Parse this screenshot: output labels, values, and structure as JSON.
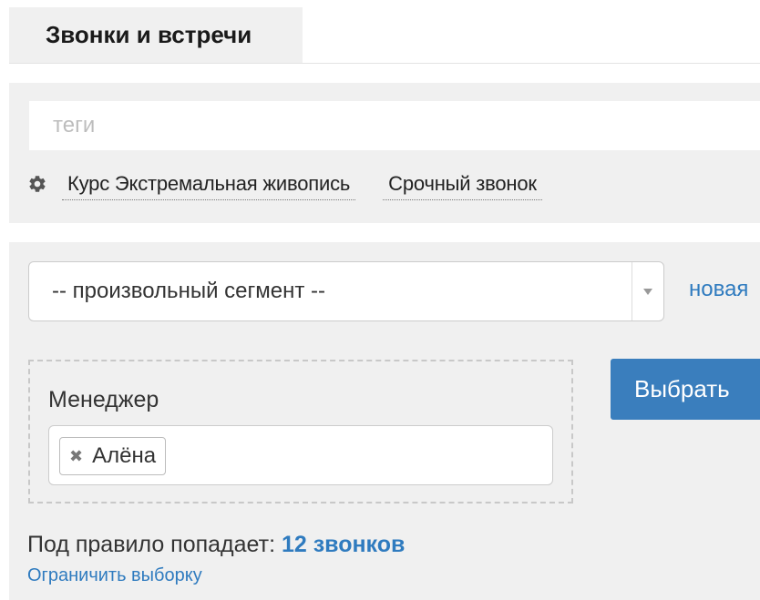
{
  "tabs": {
    "active_label": "Звонки и встречи"
  },
  "tags": {
    "placeholder": "теги",
    "items": [
      {
        "label": "Курс Экстремальная живопись"
      },
      {
        "label": "Срочный звонок"
      }
    ]
  },
  "segment": {
    "selected": "-- произвольный сегмент --",
    "new_link": "новая"
  },
  "rule": {
    "label": "Менеджер",
    "chips": [
      {
        "label": "Алёна",
        "remove_symbol": "✖"
      }
    ],
    "select_button": "Выбрать"
  },
  "summary": {
    "prefix": "Под правило попадает: ",
    "count_text": "12 звонков",
    "limit_link": "Ограничить выборку"
  },
  "colors": {
    "accent": "#2f7bbf",
    "button": "#3a7ebd",
    "panel_bg": "#f0f0f0"
  },
  "icons": {
    "tags_icon": "gear-icon",
    "dropdown_icon": "chevron-down-icon"
  }
}
